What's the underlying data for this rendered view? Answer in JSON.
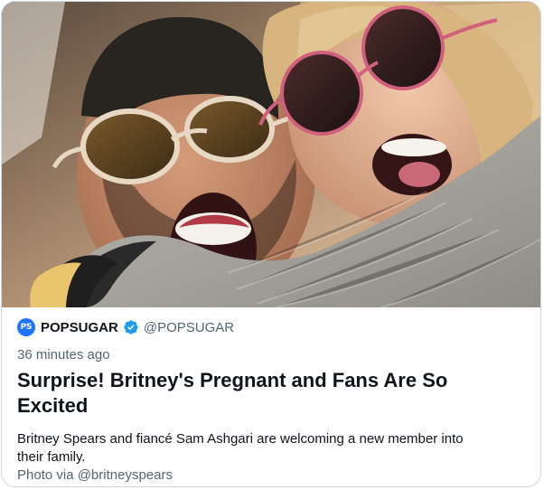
{
  "card": {
    "image_alt": "Britney Spears and Sam Ashgari",
    "logo_text": "PS",
    "source_name": "POPSUGAR",
    "source_handle": "@POPSUGAR",
    "time_ago": "36 minutes ago",
    "headline": "Surprise! Britney's Pregnant and Fans Are So Excited",
    "summary": "Britney Spears and fiancé Sam Ashgari are welcoming a new member into their family.",
    "photo_credit": "Photo via @britneyspears"
  },
  "colors": {
    "border": "#cfd9de",
    "text": "#0f1419",
    "muted": "#536471",
    "verified": "#1d9bf0",
    "logo": "#1e73ff"
  },
  "icons": {
    "verified": "verified-badge-icon",
    "logo": "popsugar-logo-icon"
  }
}
